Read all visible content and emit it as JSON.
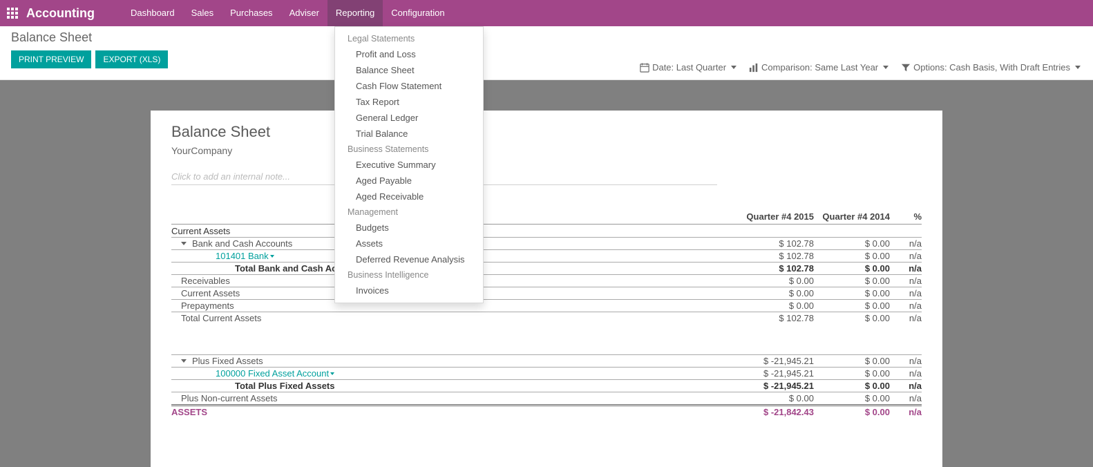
{
  "nav": {
    "brand": "Accounting",
    "items": [
      "Dashboard",
      "Sales",
      "Purchases",
      "Adviser",
      "Reporting",
      "Configuration"
    ],
    "active": "Reporting"
  },
  "control": {
    "title": "Balance Sheet",
    "print_btn": "Print Preview",
    "export_btn": "Export (XLS)",
    "filters": {
      "date": "Date: Last Quarter",
      "comparison": "Comparison: Same Last Year",
      "options": "Options: Cash Basis, With Draft Entries"
    }
  },
  "dropdown": {
    "sections": [
      {
        "label": "Legal Statements",
        "items": [
          "Profit and Loss",
          "Balance Sheet",
          "Cash Flow Statement",
          "Tax Report",
          "General Ledger",
          "Trial Balance"
        ]
      },
      {
        "label": "Business Statements",
        "items": [
          "Executive Summary",
          "Aged Payable",
          "Aged Receivable"
        ]
      },
      {
        "label": "Management",
        "items": [
          "Budgets",
          "Assets",
          "Deferred Revenue Analysis"
        ]
      },
      {
        "label": "Business Intelligence",
        "items": [
          "Invoices"
        ]
      }
    ]
  },
  "page": {
    "title": "Balance Sheet",
    "company": "YourCompany",
    "note_placeholder": "Click to add an internal note..."
  },
  "report": {
    "headers": {
      "q1": "Quarter #4 2015",
      "q2": "Quarter #4 2014",
      "pct": "%"
    },
    "section1_label": "Current Assets",
    "rows1": [
      {
        "label": "Bank and Cash Accounts",
        "q1": "$ 102.78",
        "q2": "$ 0.00",
        "pct": "n/a",
        "indent": 1,
        "caret": true
      },
      {
        "label": "101401 Bank",
        "q1": "$ 102.78",
        "q2": "$ 0.00",
        "pct": "n/a",
        "indent": 2,
        "teal": true,
        "tealcaret": true
      },
      {
        "label": "Total Bank and Cash Accounts",
        "q1": "$ 102.78",
        "q2": "$ 0.00",
        "pct": "n/a",
        "indent": 3,
        "bold": true
      },
      {
        "label": "Receivables",
        "q1": "$ 0.00",
        "q2": "$ 0.00",
        "pct": "n/a",
        "indent": 1
      },
      {
        "label": "Current Assets",
        "q1": "$ 0.00",
        "q2": "$ 0.00",
        "pct": "n/a",
        "indent": 1
      },
      {
        "label": "Prepayments",
        "q1": "$ 0.00",
        "q2": "$ 0.00",
        "pct": "n/a",
        "indent": 1
      }
    ],
    "total1": {
      "label": "Total Current Assets",
      "q1": "$ 102.78",
      "q2": "$ 0.00",
      "pct": "n/a"
    },
    "rows2": [
      {
        "label": "Plus Fixed Assets",
        "q1": "$ -21,945.21",
        "q2": "$ 0.00",
        "pct": "n/a",
        "indent": 1,
        "caret": true
      },
      {
        "label": "100000 Fixed Asset Account",
        "q1": "$ -21,945.21",
        "q2": "$ 0.00",
        "pct": "n/a",
        "indent": 2,
        "teal": true,
        "tealcaret": true
      },
      {
        "label": "Total Plus Fixed Assets",
        "q1": "$ -21,945.21",
        "q2": "$ 0.00",
        "pct": "n/a",
        "indent": 3,
        "bold": true
      },
      {
        "label": "Plus Non-current Assets",
        "q1": "$ 0.00",
        "q2": "$ 0.00",
        "pct": "n/a",
        "indent": 1
      }
    ],
    "assets": {
      "label": "ASSETS",
      "q1": "$ -21,842.43",
      "q2": "$ 0.00",
      "pct": "n/a"
    }
  }
}
